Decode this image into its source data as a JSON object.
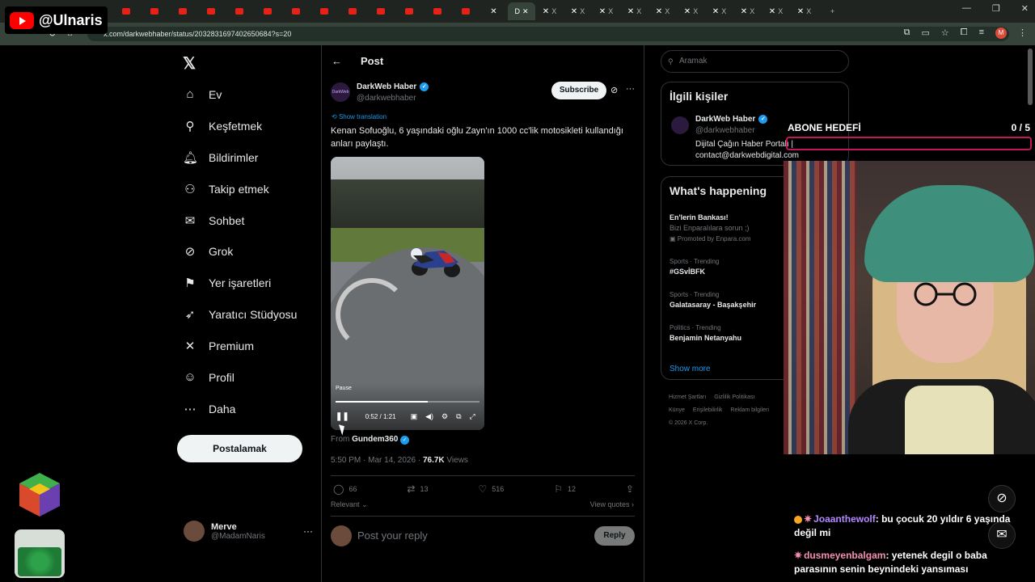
{
  "channel": {
    "name": "@Ulnaris"
  },
  "browser": {
    "active_tab_label": "D",
    "tabs_x_label": "X",
    "url": "x.com/darkwebhaber/status/2032831697402650684?s=20"
  },
  "nav": {
    "items": [
      {
        "label": "Ev",
        "icon": "home-icon",
        "glyph": "⌂"
      },
      {
        "label": "Keşfetmek",
        "icon": "search-icon",
        "glyph": "⚲"
      },
      {
        "label": "Bildirimler",
        "icon": "bell-icon",
        "glyph": "🔔︎"
      },
      {
        "label": "Takip etmek",
        "icon": "follow-icon",
        "glyph": "⚇"
      },
      {
        "label": "Sohbet",
        "icon": "mail-icon",
        "glyph": "✉"
      },
      {
        "label": "Grok",
        "icon": "grok-icon",
        "glyph": "⊘"
      },
      {
        "label": "Yer işaretleri",
        "icon": "bookmark-icon",
        "glyph": "⚑"
      },
      {
        "label": "Yaratıcı Stüdyosu",
        "icon": "rocket-icon",
        "glyph": "➶"
      },
      {
        "label": "Premium",
        "icon": "x-icon",
        "glyph": "✕"
      },
      {
        "label": "Profil",
        "icon": "profile-icon",
        "glyph": "☺"
      },
      {
        "label": "Daha",
        "icon": "more-icon",
        "glyph": "⋯"
      }
    ],
    "post_button": "Postalamak",
    "me": {
      "name": "Merve",
      "handle": "@MadamNaris"
    }
  },
  "post": {
    "header": "Post",
    "author_name": "DarkWeb Haber",
    "author_handle": "@darkwebhaber",
    "subscribe": "Subscribe",
    "show_translation": "Show translation",
    "text": "Kenan Sofuoğlu, 6 yaşındaki oğlu Zayn'ın 1000 cc'lik motosikleti kullandığı anları paylaştı.",
    "video": {
      "tooltip": "Pause",
      "time": "0:52 / 1:21",
      "progress": 0.64
    },
    "from_prefix": "From",
    "from_account": "Gundem360",
    "time": "5:50 PM · Mar 14, 2026 · ",
    "views_count": "76.7K",
    "views_label": " Views",
    "stats": {
      "replies": "66",
      "reposts": "13",
      "likes": "516",
      "bookmarks": "12"
    },
    "relevant": "Relevant",
    "view_quotes": "View quotes",
    "reply_placeholder": "Post your reply",
    "reply_button": "Reply"
  },
  "sidebar": {
    "search_placeholder": "Aramak",
    "related_title": "İlgili kişiler",
    "related": {
      "name": "DarkWeb Haber",
      "handle": "@darkwebhaber",
      "bio": "Dijital Çağın Haber Portalı | contact@darkwebdigital.com"
    },
    "happening_title": "What's happening",
    "trends": [
      {
        "category": "",
        "name": "En'lerin Bankası!",
        "desc": "Bizi Enparalılara sorun ;)",
        "promo": "Promoted by Enpara.com"
      },
      {
        "category": "Sports · Trending",
        "name": "#GSvİBFK"
      },
      {
        "category": "Sports · Trending",
        "name": "Galatasaray - Başakşehir"
      },
      {
        "category": "Politics · Trending",
        "name": "Benjamin Netanyahu"
      }
    ],
    "show_more": "Show more",
    "footer": [
      "Hizmet Şartları",
      "Gizlilik Politikası",
      "Künye",
      "Erişilebilirlik",
      "Reklam bilgileri",
      "© 2026 X Corp."
    ]
  },
  "stream": {
    "goal_label": "ABONE HEDEFİ",
    "goal_count": "0 / 5",
    "goal_progress": 0,
    "chat": [
      {
        "user": "Joaanthewolf",
        "message": ": bu çocuk 20 yıldır 6 yaşında değil mi"
      },
      {
        "user": "dusmeyenbalgam",
        "message": ": yetenek degil o baba parasının senin beynindeki yansıması"
      }
    ]
  }
}
